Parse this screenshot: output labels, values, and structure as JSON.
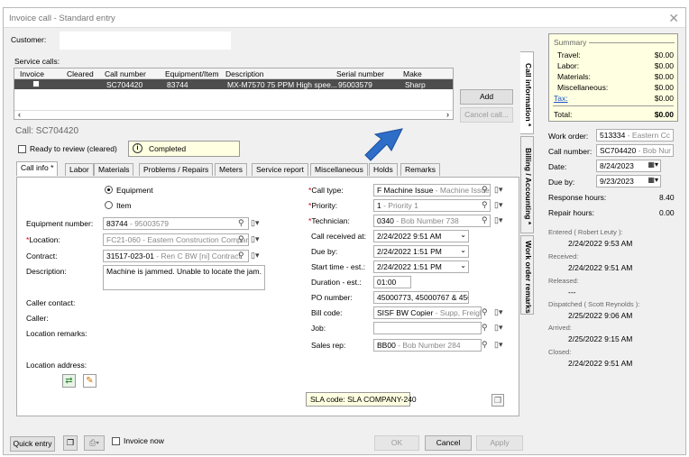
{
  "window": {
    "title": "Invoice call - Standard entry"
  },
  "customer": {
    "label": "Customer:",
    "value": ""
  },
  "service_calls": {
    "label": "Service calls:",
    "columns": [
      "Invoice",
      "Cleared",
      "Call number",
      "Equipment/Item",
      "Description",
      "Serial number",
      "Make"
    ],
    "rows": [
      {
        "invoice": false,
        "cleared": "",
        "call_number": "SC704420",
        "equipment": "83744",
        "description": "MX-M7570 75 PPM High spee...",
        "serial": "95003579",
        "make": "Sharp"
      }
    ],
    "add_label": "Add",
    "cancel_call_label": "Cancel call..."
  },
  "call": {
    "header": "Call: SC704420",
    "ready_label": "Ready to review (cleared)",
    "status": "Completed"
  },
  "tabs": [
    "Call info *",
    "Labor",
    "Materials",
    "Problems / Repairs",
    "Meters",
    "Service report",
    "Miscellaneous",
    "Holds",
    "Remarks"
  ],
  "vtabs": [
    "Call information *",
    "Billing / Accounting *",
    "Work order remarks"
  ],
  "left": {
    "equipment_label": "Equipment",
    "item_label": "Item",
    "equipment_number_label": "Equipment number:",
    "equipment_number": "83744",
    "equipment_serial": " - 95003579",
    "location_label": "Location:",
    "location": "FC21-060 - Eastern Construction Compar",
    "contract_label": "Contract:",
    "contract": "31517-023-01",
    "contract_rest": " - Ren C BW [ni] Contract",
    "description_label": "Description:",
    "description": "Machine is jammed. Unable to locate the jam.",
    "caller_contact_label": "Caller contact:",
    "caller_label": "Caller:",
    "location_remarks_label": "Location remarks:",
    "location_address_label": "Location address:"
  },
  "right": {
    "call_type_label": "Call type:",
    "call_type": "F Machine Issue",
    "call_type_rest": " - Machine Issue",
    "priority_label": "Priority:",
    "priority": "1",
    "priority_rest": " - Priority 1",
    "technician_label": "Technician:",
    "technician": "0340",
    "technician_rest": " - Bob Number 738",
    "call_received_label": "Call received at:",
    "call_received": "2/24/2022  9:51 AM",
    "due_by_label": "Due by:",
    "due_by": "2/24/2022  1:51 PM",
    "start_time_label": "Start time - est.:",
    "start_time": "2/24/2022  1:51 PM",
    "duration_label": "Duration - est.:",
    "duration": "01:00",
    "po_label": "PO number:",
    "po": "45000773, 45000767 & 450",
    "bill_code_label": "Bill code:",
    "bill_code": "SISF BW Copier",
    "bill_code_rest": " - Supp, Freight,",
    "job_label": "Job:",
    "job": "",
    "sales_rep_label": "Sales rep:",
    "sales_rep": "BB00",
    "sales_rep_rest": " - Bob Number 284",
    "sla": "SLA code: SLA COMPANY-240"
  },
  "summary": {
    "title": "Summary",
    "items": [
      {
        "label": "Travel:",
        "value": "$0.00"
      },
      {
        "label": "Labor:",
        "value": "$0.00"
      },
      {
        "label": "Materials:",
        "value": "$0.00"
      },
      {
        "label": "Miscellaneous:",
        "value": "$0.00"
      },
      {
        "label": "Tax:",
        "value": "$0.00"
      }
    ],
    "total_label": "Total:",
    "total": "$0.00"
  },
  "side": {
    "work_order_label": "Work order:",
    "work_order": "513334",
    "work_order_rest": " - Eastern Cc",
    "call_number_label": "Call number:",
    "call_number": "SC704420",
    "call_number_rest": " - Bob Nur",
    "date_label": "Date:",
    "date": "8/24/2023",
    "due_by_label": "Due by:",
    "due_by": "9/23/2023",
    "response_label": "Response hours:",
    "response": "8.40",
    "repair_label": "Repair hours:",
    "repair": "0.00",
    "events": [
      {
        "label": "Entered ( Robert Leuty ):",
        "value": "2/24/2022 9:53 AM"
      },
      {
        "label": "Received:",
        "value": "2/24/2022 9:51 AM"
      },
      {
        "label": "Released:",
        "value": "---"
      },
      {
        "label": "Dispatched ( Scott Reynolds ):",
        "value": "2/25/2022 9:06 AM"
      },
      {
        "label": "Arrived:",
        "value": "2/25/2022 9:15 AM"
      },
      {
        "label": "Closed:",
        "value": "2/24/2022 9:51 AM"
      }
    ]
  },
  "bottom": {
    "quick_entry": "Quick entry",
    "invoice_now": "Invoice now",
    "ok": "OK",
    "cancel": "Cancel",
    "apply": "Apply"
  },
  "colors": {
    "accent": "#1a56c8",
    "summary_bg": "#ffffe1",
    "arrow": "#2e6ec8",
    "selected_row": "#4d4d4d"
  }
}
